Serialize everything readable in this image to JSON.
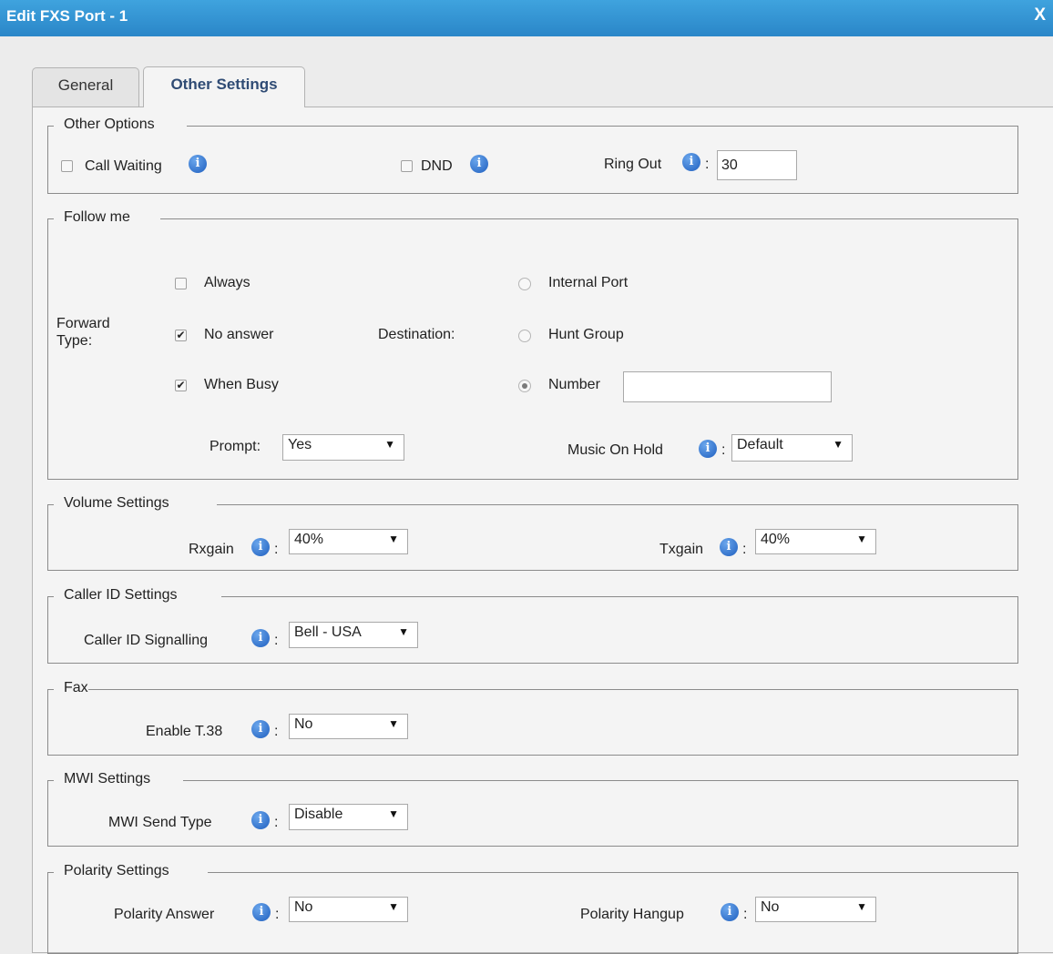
{
  "window": {
    "title": "Edit FXS Port - 1",
    "close_label": "X"
  },
  "tabs": [
    {
      "label": "General",
      "active": false
    },
    {
      "label": "Other Settings",
      "active": true
    }
  ],
  "other_options": {
    "legend": "Other Options",
    "call_waiting": {
      "label": "Call Waiting",
      "checked": false
    },
    "dnd": {
      "label": "DND",
      "checked": false
    },
    "ring_out": {
      "label": "Ring Out",
      "sep": ":",
      "value": "30"
    }
  },
  "follow_me": {
    "legend": "Follow me",
    "forward_type_label": "Forward Type:",
    "always": {
      "label": "Always",
      "checked": false
    },
    "no_answer": {
      "label": "No answer",
      "checked": true
    },
    "when_busy": {
      "label": "When Busy",
      "checked": true
    },
    "destination_label": "Destination:",
    "internal_port": {
      "label": "Internal Port",
      "selected": false
    },
    "hunt_group": {
      "label": "Hunt Group",
      "selected": false
    },
    "number": {
      "label": "Number",
      "selected": true,
      "value": ""
    },
    "prompt": {
      "label": "Prompt:",
      "value": "Yes"
    },
    "music_on_hold": {
      "label": "Music On Hold",
      "sep": ":",
      "value": "Default"
    }
  },
  "volume": {
    "legend": "Volume Settings",
    "rxgain": {
      "label": "Rxgain",
      "sep": ":",
      "value": "40%"
    },
    "txgain": {
      "label": "Txgain",
      "sep": ":",
      "value": "40%"
    }
  },
  "caller_id": {
    "legend": "Caller ID Settings",
    "signalling": {
      "label": "Caller ID Signalling",
      "sep": ":",
      "value": "Bell - USA"
    }
  },
  "fax": {
    "legend": "Fax",
    "t38": {
      "label": "Enable T.38",
      "sep": ":",
      "value": "No"
    }
  },
  "mwi": {
    "legend": "MWI Settings",
    "send_type": {
      "label": "MWI Send Type",
      "sep": ":",
      "value": "Disable"
    }
  },
  "polarity": {
    "legend": "Polarity Settings",
    "answer": {
      "label": "Polarity Answer",
      "sep": ":",
      "value": "No"
    },
    "hangup": {
      "label": "Polarity Hangup",
      "sep": ":",
      "value": "No"
    }
  },
  "icons": {
    "info": "info-icon",
    "checkmark": "✔",
    "dropdown": "▼",
    "info_glyph": "i"
  },
  "colors": {
    "titlebar": "#2a86c8",
    "accent": "#2f4b74"
  }
}
